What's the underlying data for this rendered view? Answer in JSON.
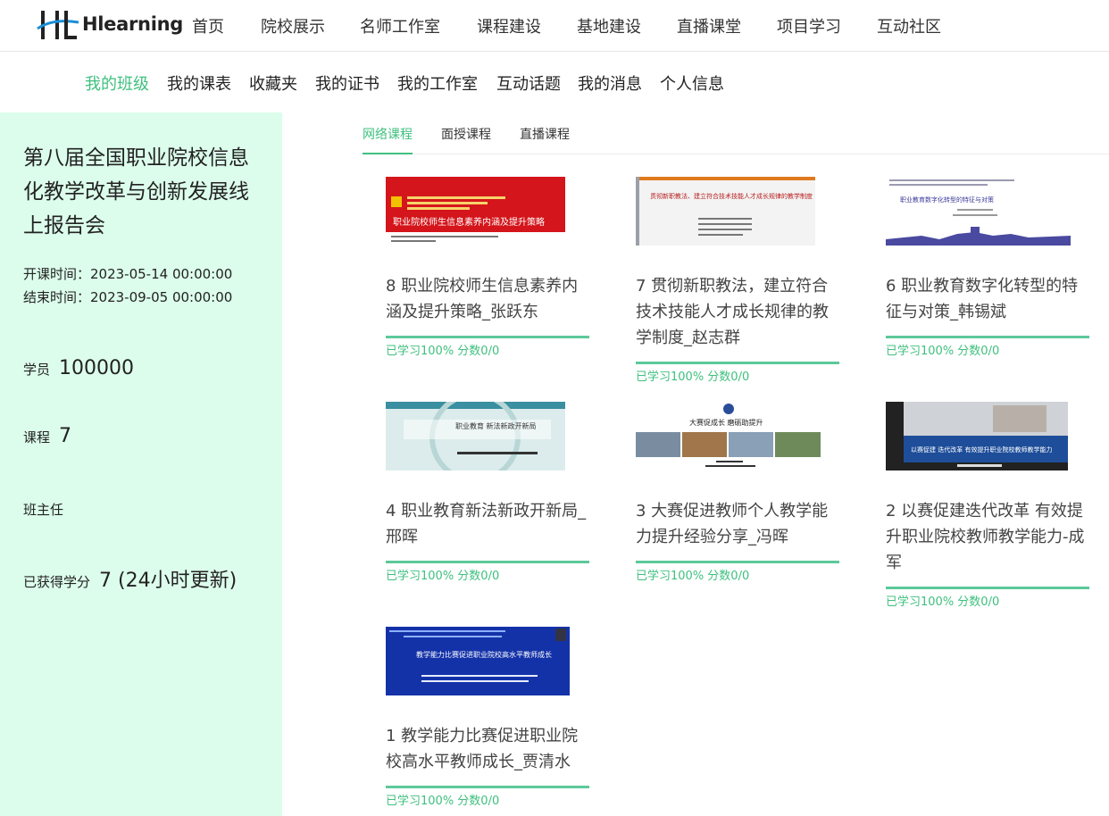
{
  "logo": {
    "text": "Hlearning"
  },
  "nav": [
    {
      "label": "首页"
    },
    {
      "label": "院校展示"
    },
    {
      "label": "名师工作室"
    },
    {
      "label": "课程建设"
    },
    {
      "label": "基地建设"
    },
    {
      "label": "直播课堂"
    },
    {
      "label": "项目学习"
    },
    {
      "label": "互动社区"
    }
  ],
  "subnav": [
    {
      "label": "我的班级"
    },
    {
      "label": "我的课表"
    },
    {
      "label": "收藏夹"
    },
    {
      "label": "我的证书"
    },
    {
      "label": "我的工作室"
    },
    {
      "label": "互动话题"
    },
    {
      "label": "我的消息"
    },
    {
      "label": "个人信息"
    }
  ],
  "side": {
    "title": "第八届全国职业院校信息化教学改革与创新发展线上报告会",
    "start": "开课时间：2023-05-14 00:00:00",
    "end": "结束时间：2023-09-05 00:00:00",
    "students_label": "学员",
    "students_value": "100000",
    "courses_label": "课程",
    "courses_value": "7",
    "teacher_label": "班主任",
    "credits_label": "已获得学分",
    "credits_value": "7 (24小时更新)"
  },
  "tabs": [
    {
      "label": "网络课程"
    },
    {
      "label": "面授课程"
    },
    {
      "label": "直播课程"
    }
  ],
  "courses": [
    {
      "title": "8 职业院校师生信息素养内涵及提升策略_张跃东",
      "progress": "已学习100% 分数0/0",
      "thumb_text": "职业院校师生信息素养内涵及提升策略"
    },
    {
      "title": "7 贯彻新职教法，建立符合技术技能人才成长规律的教学制度_赵志群",
      "progress": "已学习100% 分数0/0",
      "thumb_text": "贯彻新职教法、建立符合技术技能人才成长规律的教学制度"
    },
    {
      "title": "6 职业教育数字化转型的特征与对策_韩锡斌",
      "progress": "已学习100% 分数0/0",
      "thumb_text": "职业教育数字化转型的特征与对策"
    },
    {
      "title": "4 职业教育新法新政开新局_邢晖",
      "progress": "已学习100% 分数0/0",
      "thumb_text": "职业教育 新法新政开新局"
    },
    {
      "title": "3 大赛促进教师个人教学能力提升经验分享_冯晖",
      "progress": "已学习100% 分数0/0",
      "thumb_text": "大赛促成长 磨砺助提升"
    },
    {
      "title": "2 以赛促建迭代改革 有效提升职业院校教师教学能力-成军",
      "progress": "已学习100% 分数0/0",
      "thumb_text": "以赛促建 迭代改革 有效提升职业院校教师教学能力"
    },
    {
      "title": "1 教学能力比赛促进职业院校高水平教师成长_贾清水",
      "progress": "已学习100% 分数0/0",
      "thumb_text": "教学能力比赛促进职业院校高水平教师成长"
    }
  ],
  "colors": {
    "accent": "#3fc07f",
    "side_bg": "#dcfdec",
    "progress": "#5cc99a"
  }
}
